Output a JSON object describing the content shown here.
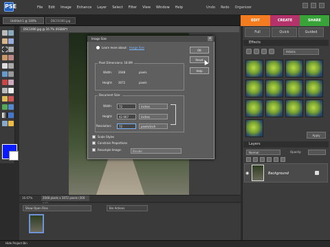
{
  "menu": {
    "logo_letter": "PSE",
    "items": [
      "File",
      "Edit",
      "Image",
      "Enhance",
      "Layer",
      "Select",
      "Filter",
      "View",
      "Window",
      "Help"
    ],
    "right_items": [
      "Undo",
      "Redo",
      "Organizer"
    ]
  },
  "modes": [
    {
      "label": "EDIT",
      "color": "#f47c20"
    },
    {
      "label": "CREATE",
      "color": "#b4336b"
    },
    {
      "label": "SHARE",
      "color": "#39a33a"
    }
  ],
  "doc_tabs": [
    "Untitled-1 @ 100%",
    "DSC01000.jpg"
  ],
  "doc_title": "DSC1000.jpg @ 16.7% (RGB/8*)",
  "status": {
    "zoom": "16.67%",
    "size": "2048 pixels x 3072 pixels (300 ppi)"
  },
  "bin": {
    "select": "Show Open Files",
    "actions": "Bin Actions"
  },
  "bottom_status": "Hide Project Bin",
  "panel": {
    "edit_tabs": [
      "Full",
      "Quick",
      "Guided"
    ],
    "effects_header": "Effects",
    "fx_select": "Artistic",
    "apply": "Apply",
    "layers_header": "Layers",
    "blend": "Normal",
    "opacity": "Opacity:",
    "layer_name": "Background"
  },
  "dialog": {
    "title": "Image Size",
    "close": "x",
    "learn": "Learn more about:",
    "learn_link": "Image Size",
    "buttons": {
      "ok": "OK",
      "reset": "Reset",
      "help": "Help"
    },
    "pixel_dimensions": {
      "legend": "Pixel Dimensions: 18.0M",
      "width_label": "Width:",
      "width_value": "2048",
      "width_unit": "pixels",
      "height_label": "Height:",
      "height_value": "3072",
      "height_unit": "pixels"
    },
    "document_size": {
      "legend": "Document Size:",
      "width_label": "Width:",
      "width_value": "72",
      "width_unit": "inches",
      "height_label": "Height:",
      "height_value": "42.667",
      "height_unit": "inches",
      "res_label": "Resolution:",
      "res_value": "72",
      "res_unit": "pixels/inch"
    },
    "checks": {
      "scale": "Scale Styles",
      "constrain": "Constrain Proportions",
      "resample": "Resample Image:",
      "resample_value": "Bicubic"
    }
  }
}
